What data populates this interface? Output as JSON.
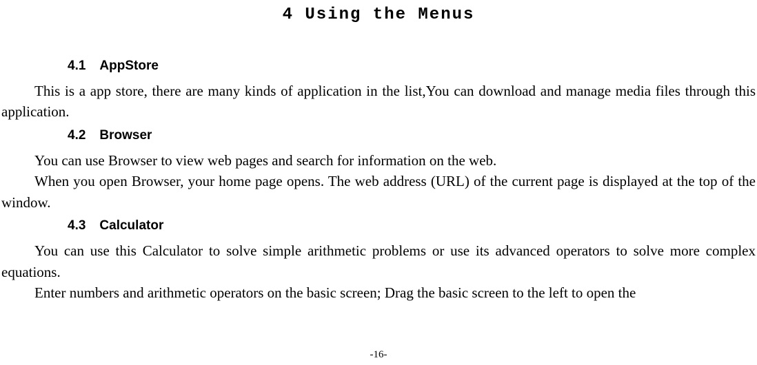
{
  "chapter": {
    "title": "4 Using the Menus"
  },
  "sections": [
    {
      "number": "4.1",
      "title": "AppStore",
      "paragraphs": [
        "This is a app store, there are many kinds of application in the list,You can download and manage media files through this application."
      ]
    },
    {
      "number": "4.2",
      "title": "Browser",
      "paragraphs": [
        "You can use Browser to view web pages and search for information on the web.",
        "When you open Browser, your home page opens. The web address (URL) of the current page is displayed at the top of the window."
      ]
    },
    {
      "number": "4.3",
      "title": "Calculator",
      "paragraphs": [
        "You can use this Calculator to solve simple arithmetic problems or use its advanced operators to solve more complex equations.",
        "Enter numbers and arithmetic operators on the basic screen; Drag the basic screen to the left to open the"
      ]
    }
  ],
  "page_number": "-16-"
}
